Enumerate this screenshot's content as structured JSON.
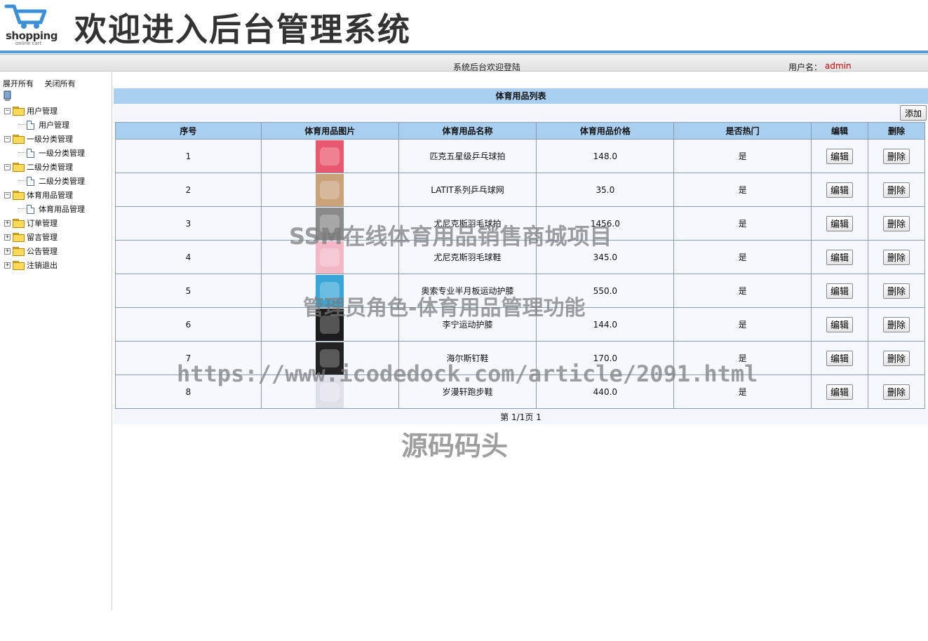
{
  "header": {
    "logo_text": "shopping",
    "logo_sub": "online cart",
    "title": "欢迎进入后台管理系统"
  },
  "topbar": {
    "welcome": "系统后台欢迎登陆",
    "user_label": "用户名：",
    "user_name": "admin"
  },
  "sidebar": {
    "expand_all": "展开所有",
    "collapse_all": "关闭所有",
    "tree": [
      {
        "label": "用户管理",
        "children": [
          "用户管理"
        ]
      },
      {
        "label": "一级分类管理",
        "children": [
          "一级分类管理"
        ]
      },
      {
        "label": "二级分类管理",
        "children": [
          "二级分类管理"
        ]
      },
      {
        "label": "体育用品管理",
        "children": [
          "体育用品管理"
        ]
      },
      {
        "label": "订单管理",
        "children": []
      },
      {
        "label": "留言管理",
        "children": []
      },
      {
        "label": "公告管理",
        "children": []
      },
      {
        "label": "注销退出",
        "children": []
      }
    ]
  },
  "main": {
    "list_title": "体育用品列表",
    "add_label": "添加",
    "columns": [
      "序号",
      "体育用品图片",
      "体育用品名称",
      "体育用品价格",
      "是否热门",
      "编辑",
      "删除"
    ],
    "edit_label": "编辑",
    "delete_label": "删除",
    "rows": [
      {
        "no": "1",
        "name": "匹克五星级乒乓球拍",
        "price": "148.0",
        "hot": "是",
        "thumb_color": "#e8586e"
      },
      {
        "no": "2",
        "name": "LATIT系列乒乓球网",
        "price": "35.0",
        "hot": "是",
        "thumb_color": "#c9a27a"
      },
      {
        "no": "3",
        "name": "尤尼克斯羽毛球拍",
        "price": "1456.0",
        "hot": "是",
        "thumb_color": "#8a8a8a"
      },
      {
        "no": "4",
        "name": "尤尼克斯羽毛球鞋",
        "price": "345.0",
        "hot": "是",
        "thumb_color": "#f2b8c6"
      },
      {
        "no": "5",
        "name": "奥索专业半月板运动护膝",
        "price": "550.0",
        "hot": "是",
        "thumb_color": "#3aa6d8"
      },
      {
        "no": "6",
        "name": "李宁运动护膝",
        "price": "144.0",
        "hot": "是",
        "thumb_color": "#1c1c1c"
      },
      {
        "no": "7",
        "name": "海尔斯钉鞋",
        "price": "170.0",
        "hot": "是",
        "thumb_color": "#222222"
      },
      {
        "no": "8",
        "name": "岁漫轩跑步鞋",
        "price": "440.0",
        "hot": "是",
        "thumb_color": "#e0e0e8"
      }
    ],
    "pager": "第 1/1页 1"
  },
  "watermarks": [
    "SSM在线体育用品销售商城项目",
    "管理员角色-体育用品管理功能",
    "https://www.icodedock.com/article/2091.html",
    "源码码头"
  ]
}
